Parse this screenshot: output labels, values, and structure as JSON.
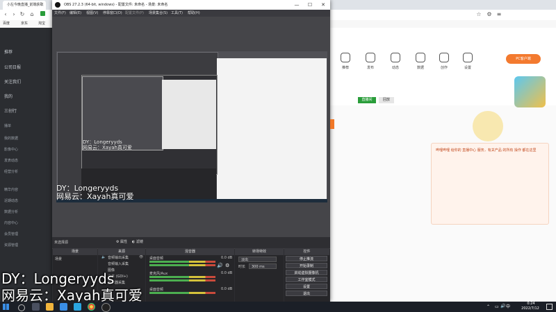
{
  "browser": {
    "tab_title": "小左今晚直播_前端获取",
    "bookmarks": [
      "百度",
      "京东",
      "淘宝"
    ],
    "sidebar_items": [
      "推荐",
      "公司日报",
      "关注我们",
      "我的",
      "三创行",
      "播单",
      "我的数据",
      "影像中心",
      "发表动态",
      "经营分析",
      "精华内容",
      "近期动态",
      "数据分析",
      "内容中心",
      "会员管理",
      "资源管理",
      "运营中心",
      "粉丝管理",
      "内容营销"
    ],
    "nav_labels": [
      "推荐",
      "发布",
      "动态",
      "数据",
      "创作",
      "设置",
      "消息"
    ],
    "promo_badge": "PC客户端",
    "tabs": [
      "直播间",
      "回放"
    ],
    "card_text": "哔哩哔哩 给你的 直播中心 服务，有关产品 的所有 操作 都在这里"
  },
  "obs": {
    "title": "OBS 27.2.3 (64-bit, windows) - 配置文件: 未命名 - 场景: 未命名",
    "menu": [
      "文件(F)",
      "编辑(E)",
      "视图(V)",
      "停靠窗口(D)",
      "配置文件(P)",
      "场景集合(S)",
      "工具(T)",
      "帮助(H)"
    ],
    "window_controls": [
      "—",
      "☐",
      "✕"
    ],
    "docks": {
      "status_label": "未选择源",
      "props_button": "属性",
      "filters_button": "滤镜",
      "scenes_header": "场景",
      "sources_header": "来源",
      "mixer_header": "混音器",
      "transitions_header": "转场特效",
      "controls_header": "控件",
      "scene_item": "场景",
      "sources": [
        "音频输出采集",
        "音频输入采集",
        "图像",
        "文本 (GDI+)",
        "显示器采集"
      ],
      "mixer_tracks": [
        {
          "name": "桌面音频",
          "db": "0.0 dB"
        },
        {
          "name": "麦克风/Aux",
          "db": "0.0 dB"
        },
        {
          "name": "桌面音频",
          "db": "0.0 dB"
        }
      ],
      "transition_type": "淡出",
      "duration_label": "时长",
      "duration_value": "300 ms",
      "controls": [
        "停止推流",
        "开始录制",
        "启动虚拟摄像机",
        "工作室模式",
        "设置",
        "退出"
      ]
    }
  },
  "overlay": {
    "line1": "DY：Longeryyds",
    "line2": "网易云：Xayah真可爱"
  },
  "taskbar": {
    "time": "0:24",
    "date": "2022/7/12",
    "tray_lang": "中"
  }
}
